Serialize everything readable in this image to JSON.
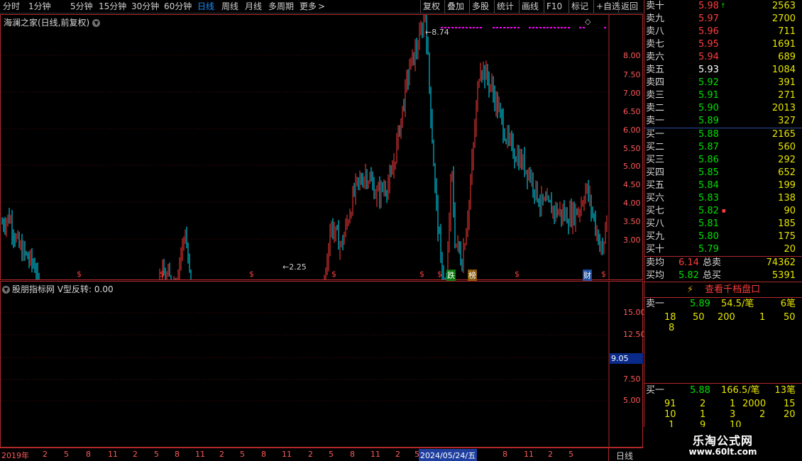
{
  "toolbar": {
    "left_items": [
      "分时",
      "1分钟",
      "5分钟",
      "15分钟",
      "30分钟",
      "60分钟",
      "日线",
      "周线",
      "月线",
      "多周期",
      "更多"
    ],
    "active": "日线",
    "more_arrow": ">",
    "right_items": [
      "复权",
      "叠加",
      "多股",
      "统计",
      "画线",
      "F10",
      "标记",
      "+自选",
      "返回"
    ]
  },
  "main_panel": {
    "title": "海澜之家(日线,前复权)",
    "y_labels": [
      "8.00",
      "7.50",
      "7.00",
      "6.50",
      "6.00",
      "5.50",
      "5.00",
      "4.50",
      "4.00",
      "3.50",
      "3.00"
    ],
    "high_marker": "8.74",
    "low_marker": "2.25",
    "event_marks": [
      "$",
      "$",
      "$",
      "$",
      "$",
      "$",
      "$",
      "$"
    ],
    "tag_die": "跌",
    "tag_bang": "榜",
    "tag_cai": "财",
    "diamond": "◇"
  },
  "sub_panel": {
    "title": "股朋指标网 V型反转: 0.00",
    "y_labels": [
      "15.00",
      "12.50",
      "7.50",
      "5.00"
    ],
    "current_value": "9.05"
  },
  "x_axis": {
    "labels": [
      "2019年",
      "2",
      "5",
      "8",
      "11",
      "2",
      "5",
      "8",
      "11",
      "2",
      "5",
      "8",
      "11",
      "2",
      "5",
      "8",
      "11",
      "2",
      "5",
      "8",
      "11",
      "2",
      "5"
    ],
    "cursor_date": "2024/05/24/五",
    "period": "日线"
  },
  "order_book": {
    "sells": [
      {
        "label": "卖十",
        "price": "5.98",
        "vol": "2563",
        "mark": "up"
      },
      {
        "label": "卖九",
        "price": "5.97",
        "vol": "2700"
      },
      {
        "label": "卖八",
        "price": "5.96",
        "vol": "711"
      },
      {
        "label": "卖七",
        "price": "5.95",
        "vol": "1691"
      },
      {
        "label": "卖六",
        "price": "5.94",
        "vol": "689"
      },
      {
        "label": "卖五",
        "price": "5.93",
        "vol": "1084"
      },
      {
        "label": "卖四",
        "price": "5.92",
        "vol": "391"
      },
      {
        "label": "卖三",
        "price": "5.91",
        "vol": "271"
      },
      {
        "label": "卖二",
        "price": "5.90",
        "vol": "2013"
      },
      {
        "label": "卖一",
        "price": "5.89",
        "vol": "327"
      }
    ],
    "buys": [
      {
        "label": "买一",
        "price": "5.88",
        "vol": "2165"
      },
      {
        "label": "买二",
        "price": "5.87",
        "vol": "560"
      },
      {
        "label": "买三",
        "price": "5.86",
        "vol": "292"
      },
      {
        "label": "买四",
        "price": "5.85",
        "vol": "652"
      },
      {
        "label": "买五",
        "price": "5.84",
        "vol": "199"
      },
      {
        "label": "买六",
        "price": "5.83",
        "vol": "138"
      },
      {
        "label": "买七",
        "price": "5.82",
        "vol": "90",
        "mark": "dot"
      },
      {
        "label": "买八",
        "price": "5.81",
        "vol": "185"
      },
      {
        "label": "买九",
        "price": "5.80",
        "vol": "175"
      },
      {
        "label": "买十",
        "price": "5.79",
        "vol": "20"
      }
    ],
    "sell_avg_label": "卖均",
    "sell_avg": "6.14",
    "sell_total_label": "总卖",
    "sell_total": "74362",
    "buy_avg_label": "买均",
    "buy_avg": "5.82",
    "buy_total_label": "总买",
    "buy_total": "5391",
    "depth_button": "查看千档盘口",
    "queue_sell": {
      "label": "卖一",
      "price": "5.89",
      "avg": "54.5/笔",
      "count": "6笔",
      "nums": [
        "18",
        "50",
        "200",
        "1",
        "50",
        "8"
      ]
    },
    "queue_buy": {
      "label": "买一",
      "price": "5.88",
      "avg": "166.5/笔",
      "count": "13笔",
      "nums": [
        "91",
        "2",
        "1",
        "2000",
        "15",
        "10",
        "1",
        "3",
        "2",
        "20",
        "1",
        "9",
        "10"
      ]
    }
  },
  "logo": {
    "name": "乐淘公式网",
    "url": "www.60lt.com"
  },
  "colors": {
    "up": "#ff3c3c",
    "down": "#00e5ff",
    "frame": "#b0282a",
    "accent": "#1e90ff"
  }
}
